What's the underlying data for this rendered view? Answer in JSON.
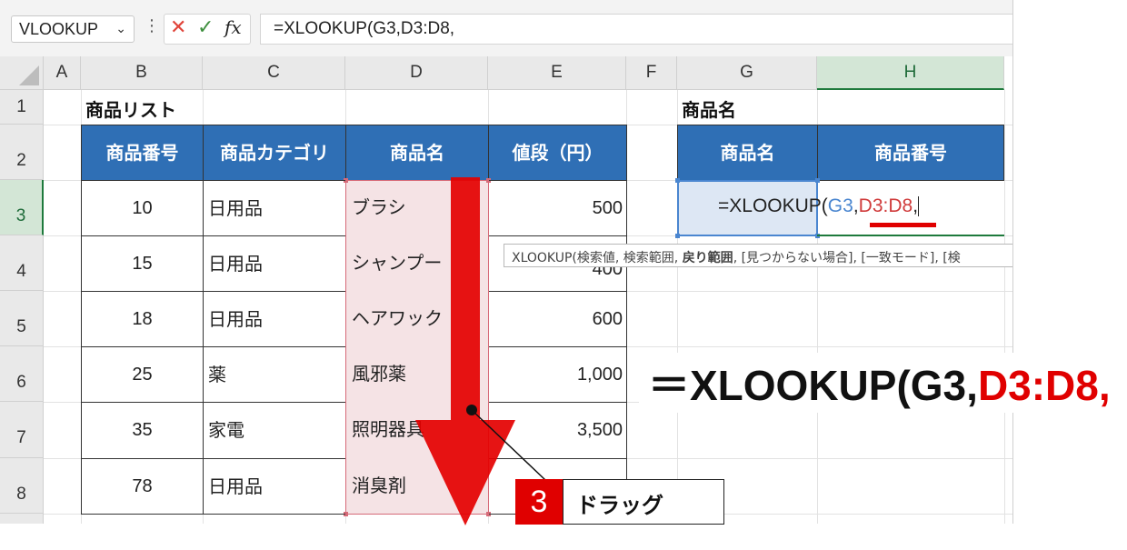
{
  "formula_bar": {
    "name_box": "VLOOKUP",
    "name_box_icon": "chevron-down-icon",
    "cancel_icon": "✕",
    "enter_icon": "✓",
    "fx_label": "fx",
    "formula": "=XLOOKUP(G3,D3:D8,"
  },
  "columns": [
    "A",
    "B",
    "C",
    "D",
    "E",
    "F",
    "G",
    "H"
  ],
  "rows": [
    "1",
    "2",
    "3",
    "4",
    "5",
    "6",
    "7",
    "8"
  ],
  "product_list": {
    "title": "商品リスト",
    "headers": [
      "商品番号",
      "商品カテゴリ",
      "商品名",
      "値段（円）"
    ],
    "rows": [
      {
        "number": "10",
        "category": "日用品",
        "name": "ブラシ",
        "price": "500"
      },
      {
        "number": "15",
        "category": "日用品",
        "name": "シャンプー",
        "price": "400"
      },
      {
        "number": "18",
        "category": "日用品",
        "name": "ヘアワック",
        "price": "600"
      },
      {
        "number": "25",
        "category": "薬",
        "name": "風邪薬",
        "price": "1,000"
      },
      {
        "number": "35",
        "category": "家電",
        "name": "照明器具",
        "price": "3,500"
      },
      {
        "number": "78",
        "category": "日用品",
        "name": "消臭剤",
        "price": ""
      }
    ]
  },
  "lookup_table": {
    "title": "商品名",
    "headers": [
      "商品名",
      "商品番号"
    ],
    "formula_parts": {
      "prefix": "=XLOOKUP(",
      "ref1": "G3",
      "comma1": ",",
      "ref2": "D3:D8",
      "comma2": ","
    }
  },
  "tooltip": {
    "before": "XLOOKUP(検索値, 検索範囲, ",
    "bold": "戻り範囲",
    "after": ", [見つからない場合], [一致モード], [検"
  },
  "annotation": {
    "formula_prefix": "＝XLOOKUP(G3,",
    "formula_highlight": "D3:D8,",
    "step_number": "3",
    "step_label": "ドラッグ"
  },
  "colors": {
    "header_blue": "#2f6fb5",
    "selection_pink": "#f5e3e5",
    "accent_red": "#e00000",
    "ref_blue": "#4a86d0",
    "excel_green": "#1e7a3c"
  }
}
